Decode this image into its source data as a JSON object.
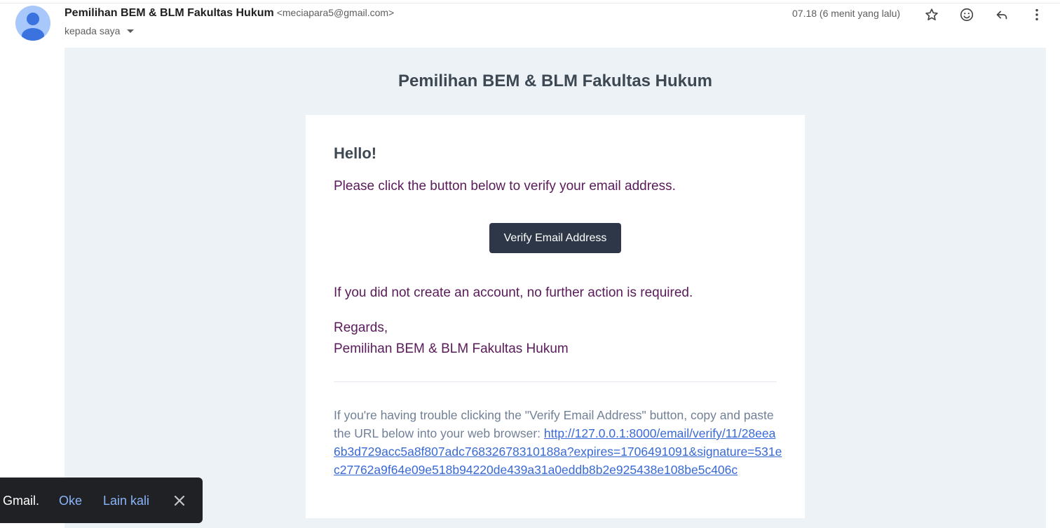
{
  "header": {
    "sender_name": "Pemilihan BEM & BLM Fakultas Hukum",
    "sender_email": "<meciapara5@gmail.com>",
    "recipient_label": "kepada saya",
    "time": "07.18 (6 menit yang lalu)",
    "icons": [
      "star-icon",
      "emoji-icon",
      "reply-icon",
      "more-vert-icon"
    ]
  },
  "email": {
    "header_title": "Pemilihan BEM & BLM Fakultas Hukum",
    "greeting": "Hello!",
    "line1": "Please click the button below to verify your email address.",
    "button_label": "Verify Email Address",
    "line2": "If you did not create an account, no further action is required.",
    "regards": "Regards,",
    "signature": "Pemilihan BEM & BLM Fakultas Hukum",
    "trouble_text": "If you're having trouble clicking the \"Verify Email Address\" button, copy and paste the URL below into your web browser: ",
    "verify_url": "http://127.0.0.1:8000/email/verify/11/28eea6b3d729acc5a8f807adc76832678310188a?expires=1706491091&signature=531ec27762a9f64e09e518b94220de439a31a0eddb8b2e925438e108be5c406c"
  },
  "toast": {
    "text": "Gmail.",
    "ok_label": "Oke",
    "later_label": "Lain kali"
  },
  "colors": {
    "email_bg": "#edf2f7",
    "button_bg": "#2d3748",
    "body_text": "#5a1a5a",
    "link": "#3869d4",
    "toast_bg": "#202124",
    "toast_action": "#8ab4f8"
  }
}
